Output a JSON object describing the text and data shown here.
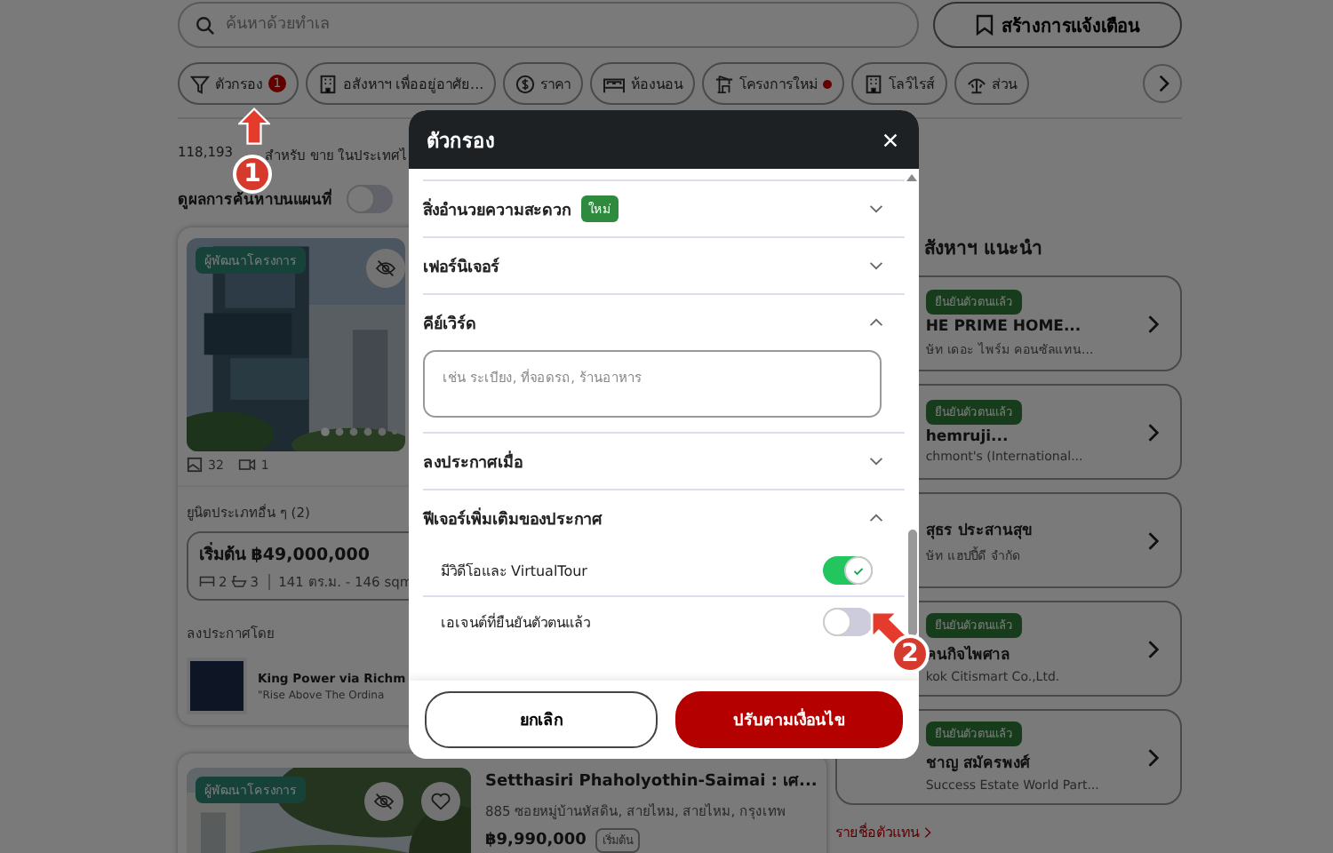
{
  "search": {
    "placeholder": "ค้นหาด้วยทำเล"
  },
  "alert_button": "สร้างการแจ้งเตือน",
  "filter_chips": [
    {
      "kind": "filter",
      "label": "ตัวกรอง",
      "count": "1"
    },
    {
      "kind": "building",
      "label": "อสังหาฯ เพื่ออยู่อาศัย..."
    },
    {
      "kind": "price",
      "label": "ราคา"
    },
    {
      "kind": "bed",
      "label": "ห้องนอน"
    },
    {
      "kind": "crane",
      "label": "โครงการใหม่",
      "dot": true
    },
    {
      "kind": "building",
      "label": "โลว์ไรส์"
    },
    {
      "kind": "park",
      "label": "ส่วน"
    }
  ],
  "results": {
    "count": "118,193",
    "text": "สำหรับ ขาย ในประเทศไ"
  },
  "map_toggle": {
    "label": "ดูผลการค้นหาบนแผนที่",
    "on": false
  },
  "project_card": {
    "tag": "ผู้พัฒนาโครงการ",
    "photos": "32",
    "videos": "1",
    "units_label": "ยูนิตประเภทอื่น ๆ (2)",
    "unit_price": "เริ่มต้น ฿49,000,000",
    "beds": "2",
    "baths": "3",
    "area": "141 ตร.ม. - 146 sqm",
    "posted_by_label": "ลงประกาศโดย",
    "agent_name": "King Power via Richm",
    "agent_tagline": "\"Rise Above The Ordina"
  },
  "compact_card": {
    "tag": "ผู้พัฒนาโครงการ",
    "title": "Setthasiri Phaholyothin-Saimai : เศ...",
    "address": "885 ซอยหมู่บ้านหัสดิน, สายไหม, สายไหม, กรุงเทพ",
    "price": "฿9,990,000",
    "price_tag": "เริ่มต้น"
  },
  "recommended": {
    "title": "สังหาฯ แนะนำ",
    "agents": [
      {
        "badge": "ยืนยันตัวตนแล้ว",
        "name": "HE PRIME HOME...",
        "company": "ษัท เดอะ ไพร์ม คอนซัลแทน..."
      },
      {
        "badge": "ยืนยันตัวตนแล้ว",
        "name": "hemruji...",
        "company": "chmont's (International..."
      },
      {
        "name": "สุธร ประสานสุข",
        "company": "ษัท แฮปปี้ดี จำกัด"
      },
      {
        "badge": "ยืนยันตัวตนแล้ว",
        "name": "คนกิจไพศาล",
        "company": "kok Citismart Co.,Ltd."
      },
      {
        "badge": "ยืนยันตัวตนแล้ว",
        "name": "ชาญ สมัครพงศ์",
        "company": "Success Estate World Part..."
      }
    ],
    "link": "รายชื่อตัวแทน"
  },
  "modal": {
    "title": "ตัวกรอง",
    "sections": [
      {
        "title": "สิ่งอำนวยความสะดวก",
        "badge": "ใหม่",
        "expanded": false
      },
      {
        "title": "เฟอร์นิเจอร์",
        "expanded": false
      },
      {
        "title": "คีย์เวิร์ด",
        "expanded": true,
        "placeholder": "เช่น ระเบียง, ที่จอดรถ, ร้านอาหาร"
      },
      {
        "title": "ลงประกาศเมื่อ",
        "expanded": false
      },
      {
        "title": "ฟีเจอร์เพิ่มเติมของประกาศ",
        "expanded": true,
        "toggles": [
          {
            "label": "มีวิดีโอและ VirtualTour",
            "on": true
          },
          {
            "label": "เอเจนต์ที่ยืนยันตัวตนแล้ว",
            "on": false
          }
        ]
      }
    ],
    "cancel": "ยกเลิก",
    "apply": "ปรับตามเงื่อนไข"
  },
  "annotations": [
    {
      "label": "1"
    },
    {
      "label": "2"
    }
  ]
}
